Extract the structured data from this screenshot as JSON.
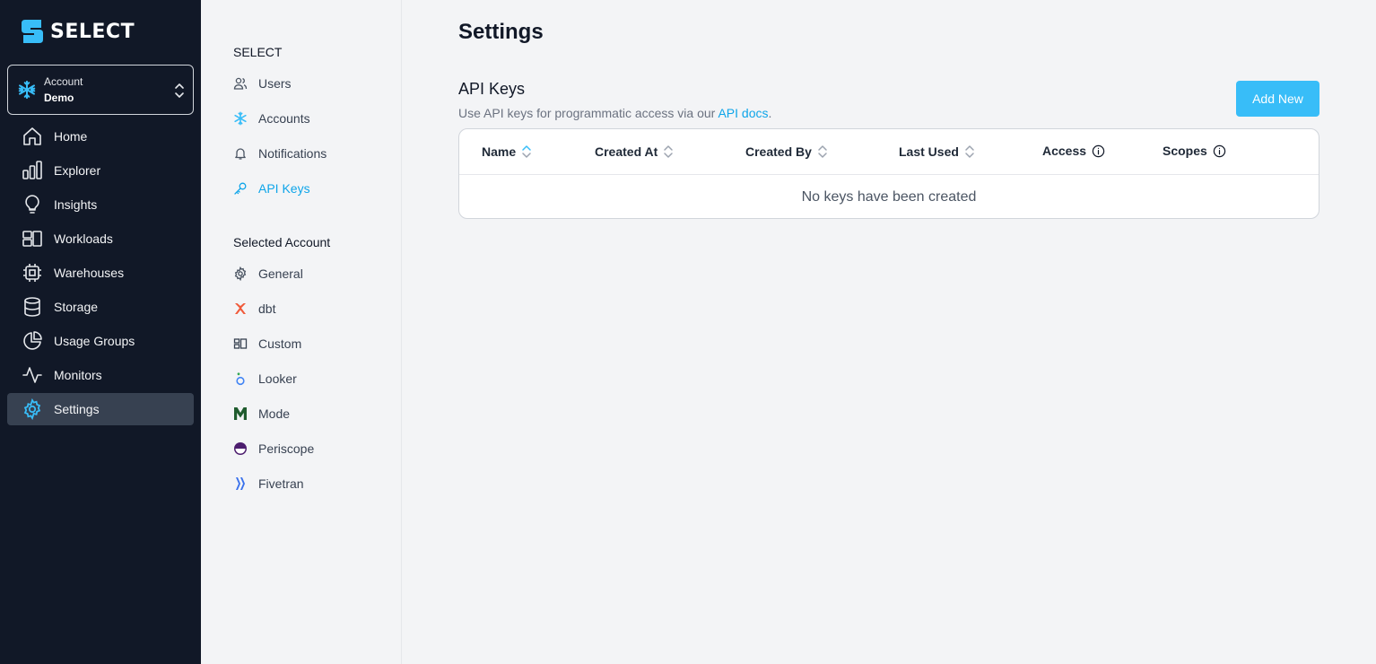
{
  "brand": {
    "name": "SELECT",
    "accent": "#38bdf8",
    "sidebar_bg": "#111827"
  },
  "account": {
    "label": "Account",
    "value": "Demo"
  },
  "nav": {
    "items": [
      {
        "label": "Home",
        "icon": "home-icon"
      },
      {
        "label": "Explorer",
        "icon": "bar-chart-icon"
      },
      {
        "label": "Insights",
        "icon": "lightbulb-icon"
      },
      {
        "label": "Workloads",
        "icon": "workloads-icon"
      },
      {
        "label": "Warehouses",
        "icon": "chip-icon"
      },
      {
        "label": "Storage",
        "icon": "database-icon"
      },
      {
        "label": "Usage Groups",
        "icon": "pie-chart-icon"
      },
      {
        "label": "Monitors",
        "icon": "activity-icon"
      },
      {
        "label": "Settings",
        "icon": "gear-icon",
        "active": true
      }
    ]
  },
  "settings_nav": {
    "select_heading": "SELECT",
    "select_items": [
      {
        "label": "Users",
        "icon": "users-icon"
      },
      {
        "label": "Accounts",
        "icon": "snowflake-icon"
      },
      {
        "label": "Notifications",
        "icon": "bell-icon"
      },
      {
        "label": "API Keys",
        "icon": "key-icon",
        "active": true
      }
    ],
    "account_heading": "Selected Account",
    "account_items": [
      {
        "label": "General",
        "icon": "gear-icon"
      },
      {
        "label": "dbt",
        "icon": "dbt-icon"
      },
      {
        "label": "Custom",
        "icon": "custom-icon"
      },
      {
        "label": "Looker",
        "icon": "looker-icon"
      },
      {
        "label": "Mode",
        "icon": "mode-icon"
      },
      {
        "label": "Periscope",
        "icon": "periscope-icon"
      },
      {
        "label": "Fivetran",
        "icon": "fivetran-icon"
      }
    ]
  },
  "main": {
    "title": "Settings",
    "section_title": "API Keys",
    "section_desc_prefix": "Use API keys for programmatic access via our ",
    "section_desc_link": "API docs",
    "section_desc_suffix": ".",
    "add_button": "Add New",
    "table": {
      "columns": [
        {
          "label": "Name",
          "type": "sort-active"
        },
        {
          "label": "Created At",
          "type": "sort"
        },
        {
          "label": "Created By",
          "type": "sort"
        },
        {
          "label": "Last Used",
          "type": "sort"
        },
        {
          "label": "Access",
          "type": "info"
        },
        {
          "label": "Scopes",
          "type": "info"
        }
      ],
      "empty_message": "No keys have been created"
    }
  }
}
